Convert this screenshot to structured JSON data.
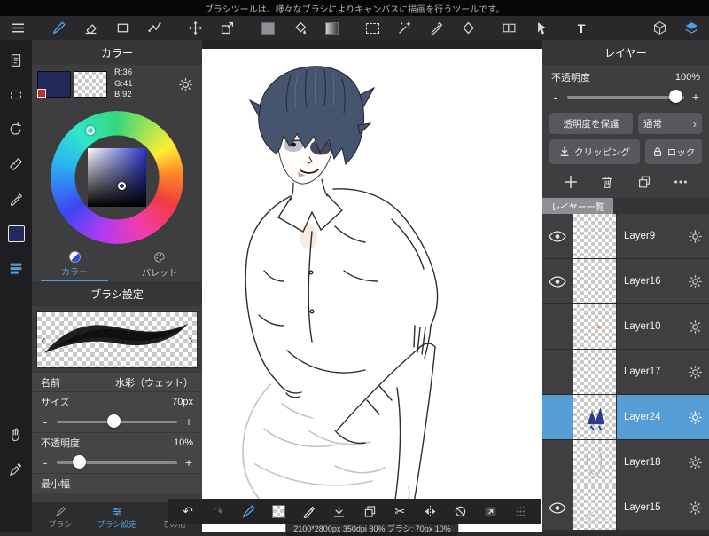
{
  "top_bar": {
    "hint_text": "ブラシツールは、様々なブラシによりキャンバスに描画を行うツールです。"
  },
  "toolbar": {
    "text_tool_label": "T",
    "icons": [
      "menu-icon",
      "brush-tool-icon",
      "eraser-tool-icon",
      "shape-tool-icon",
      "polyline-tool-icon",
      "move-tool-icon",
      "transform-tool-icon",
      "foreground-color-swatch",
      "bucket-tool-icon",
      "gradient-tool-icon",
      "select-tool-icon",
      "magic-wand-icon",
      "select-pen-icon",
      "select-eraser-icon",
      "divide-window-icon",
      "object-select-icon",
      "text-tool-icon",
      "material-3d-icon",
      "layers-panel-icon"
    ]
  },
  "left_strip": {
    "icons": [
      "page-icon",
      "marquee-icon",
      "rotate-canvas-icon",
      "ruler-icon",
      "decor-pen-icon",
      "current-color-swatch",
      "materials-icon",
      "hand-icon",
      "eyedropper-icon"
    ]
  },
  "color_panel": {
    "title": "カラー",
    "rgb": {
      "r": "R:36",
      "g": "G:41",
      "b": "B:92"
    },
    "tabs": [
      {
        "label": "カラー"
      },
      {
        "label": "パレット"
      }
    ],
    "brush_title": "ブラシ設定",
    "brush_name_label": "名前",
    "brush_name_value": "水彩（ウェット）",
    "size_label": "サイズ",
    "size_value": "70px",
    "opacity_label": "不透明度",
    "opacity_value": "10%",
    "min_width_label": "最小幅",
    "bottom_tabs": [
      {
        "label": "ブラシ"
      },
      {
        "label": "ブラシ設定"
      },
      {
        "label": "その他"
      }
    ]
  },
  "layer_panel": {
    "title": "レイヤー",
    "opacity_label": "不透明度",
    "opacity_value": "100%",
    "protect_alpha_label": "透明度を保護",
    "blend_mode_label": "通常",
    "clipping_label": "クリッピング",
    "lock_label": "ロック",
    "list_header": "レイヤー一覧",
    "layers": [
      {
        "name": "Layer9",
        "visible": true,
        "selected": false
      },
      {
        "name": "Layer16",
        "visible": true,
        "selected": false
      },
      {
        "name": "Layer10",
        "visible": false,
        "selected": false
      },
      {
        "name": "Layer17",
        "visible": false,
        "selected": false
      },
      {
        "name": "Layer24",
        "visible": false,
        "selected": true
      },
      {
        "name": "Layer18",
        "visible": false,
        "selected": false
      },
      {
        "name": "Layer15",
        "visible": true,
        "selected": false
      }
    ]
  },
  "bottom_bar": {
    "status_text": "2100*2800px 350dpi 80% ブラシ: 70px 10%",
    "icons": [
      "undo-icon",
      "redo-icon",
      "brush-color-icon",
      "transparent-color-icon",
      "pen-icon",
      "save-icon",
      "duplicate-icon",
      "scissors-icon",
      "flip-icon",
      "rotate-reset-icon",
      "material-panel-icon",
      "drag-handle-icon"
    ]
  },
  "ui": {
    "minus": "-",
    "plus": "+",
    "prev": "‹",
    "next": "›",
    "chevron": "›",
    "undo_glyph": "↶",
    "redo_glyph": "↷",
    "scissors_glyph": "✂"
  },
  "colors": {
    "accent_blue": "#4da0dc",
    "selected_layer_row": "#569dd6",
    "current_color": "#24295c"
  }
}
